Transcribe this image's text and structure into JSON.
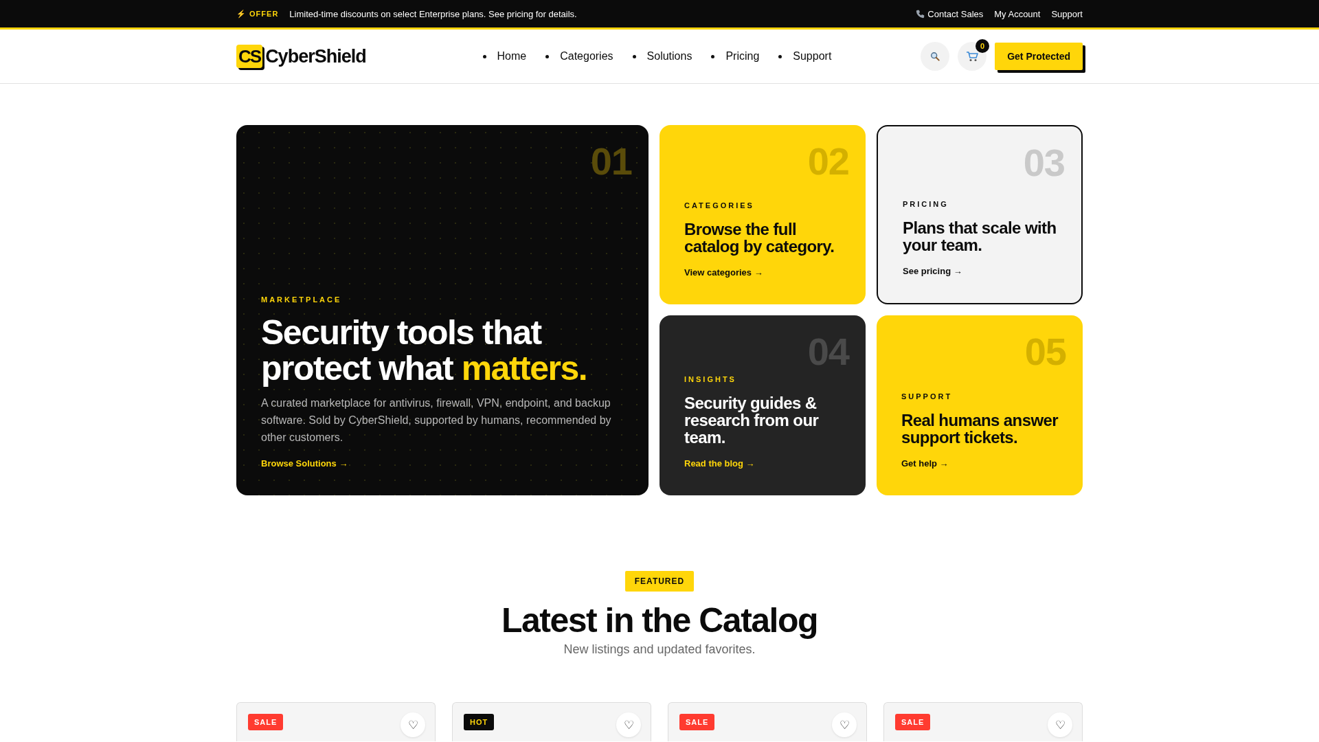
{
  "top_bar": {
    "offer_badge": "⚡ OFFER",
    "message": "Limited-time discounts on select Enterprise plans. See pricing for details.",
    "links": [
      {
        "label": "Contact Sales"
      },
      {
        "label": "My Account"
      },
      {
        "label": "Support"
      }
    ]
  },
  "header": {
    "logo_mark": "CS",
    "logo_text": "CyberShield",
    "nav": [
      {
        "label": "Home"
      },
      {
        "label": "Categories"
      },
      {
        "label": "Solutions"
      },
      {
        "label": "Pricing"
      },
      {
        "label": "Support"
      }
    ],
    "cart_count": "0",
    "cta": "Get Protected"
  },
  "hero": {
    "number": "01",
    "eyebrow": "MARKETPLACE",
    "title": "Security tools that protect what ",
    "title_highlight": "matters.",
    "description": "A curated marketplace for antivirus, firewall, VPN, endpoint, and backup software. Sold by CyberShield, supported by humans, recommended by other customers.",
    "link": "Browse Solutions →"
  },
  "tiles": [
    {
      "kind": "yellow",
      "number": "02",
      "eyebrow": "CATEGORIES",
      "title": "Browse the full catalog by category.",
      "link": "View categories →"
    },
    {
      "kind": "light",
      "number": "03",
      "eyebrow": "PRICING",
      "title": "Plans that scale with your team.",
      "link": "See pricing →"
    },
    {
      "kind": "dark",
      "number": "04",
      "eyebrow": "INSIGHTS",
      "title": "Security guides & research from our team.",
      "link": "Read the blog →"
    },
    {
      "kind": "yellow",
      "number": "05",
      "eyebrow": "SUPPORT",
      "title": "Real humans answer support tickets.",
      "link": "Get help →"
    }
  ],
  "featured": {
    "badge": "FEATURED",
    "title": "Latest in the Catalog",
    "subtitle": "New listings and updated favorites.",
    "products": [
      {
        "badge": "SALE",
        "kind": "sale",
        "favorite": "♡"
      },
      {
        "badge": "HOT",
        "kind": "hot",
        "favorite": "♡"
      },
      {
        "badge": "SALE",
        "kind": "sale",
        "favorite": "♡"
      },
      {
        "badge": "SALE",
        "kind": "sale",
        "favorite": "♡"
      }
    ]
  }
}
